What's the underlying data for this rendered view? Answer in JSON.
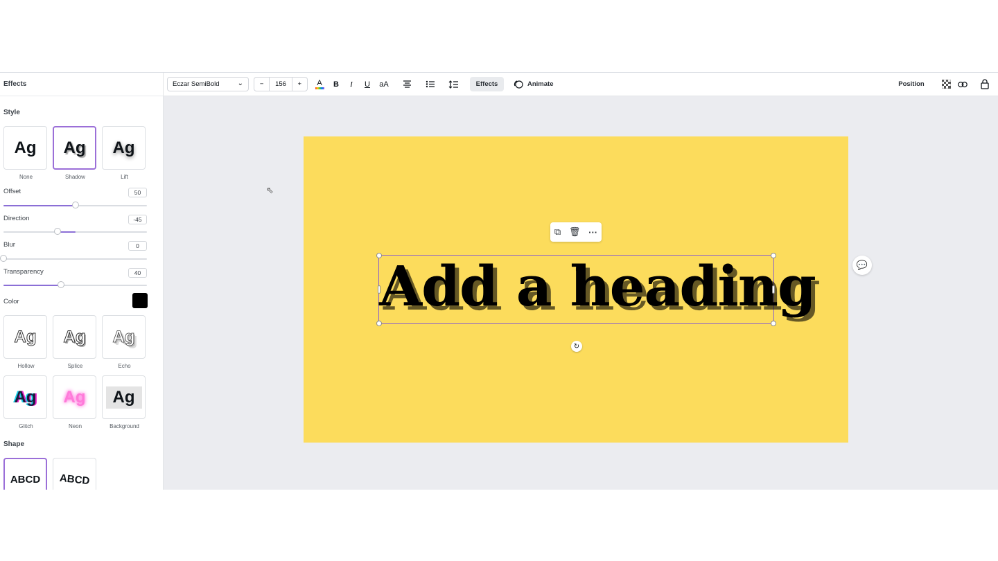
{
  "panel": {
    "title": "Effects",
    "style_section": "Style",
    "styles_top": [
      {
        "label": "None",
        "sample": "Ag"
      },
      {
        "label": "Shadow",
        "sample": "Ag"
      },
      {
        "label": "Lift",
        "sample": "Ag"
      }
    ],
    "sliders": [
      {
        "label": "Offset",
        "value": "50",
        "fraction": 0.5
      },
      {
        "label": "Direction",
        "value": "-45",
        "fraction": 0.38
      },
      {
        "label": "Blur",
        "value": "0",
        "fraction": 0.0
      },
      {
        "label": "Transparency",
        "value": "40",
        "fraction": 0.4
      }
    ],
    "color_label": "Color",
    "color_value": "#000000",
    "styles_bottom": [
      {
        "label": "Hollow",
        "sample": "Ag"
      },
      {
        "label": "Splice",
        "sample": "Ag"
      },
      {
        "label": "Echo",
        "sample": "Ag"
      },
      {
        "label": "Glitch",
        "sample": "Ag"
      },
      {
        "label": "Neon",
        "sample": "Ag"
      },
      {
        "label": "Background",
        "sample": "Ag"
      }
    ],
    "shape_section": "Shape",
    "shapes": [
      {
        "sample": "ABCD"
      },
      {
        "sample": "ABCD"
      }
    ]
  },
  "toolbar": {
    "font": "Eczar SemiBold",
    "minus": "−",
    "size": "156",
    "plus": "+",
    "text_color_icon": "A",
    "bold": "B",
    "italic": "I",
    "underline": "U",
    "case": "aA",
    "effects": "Effects",
    "animate": "Animate",
    "position": "Position"
  },
  "canvas": {
    "heading": "Add a heading",
    "page_color": "#fcdc5c",
    "accent": "#8b3dff"
  }
}
